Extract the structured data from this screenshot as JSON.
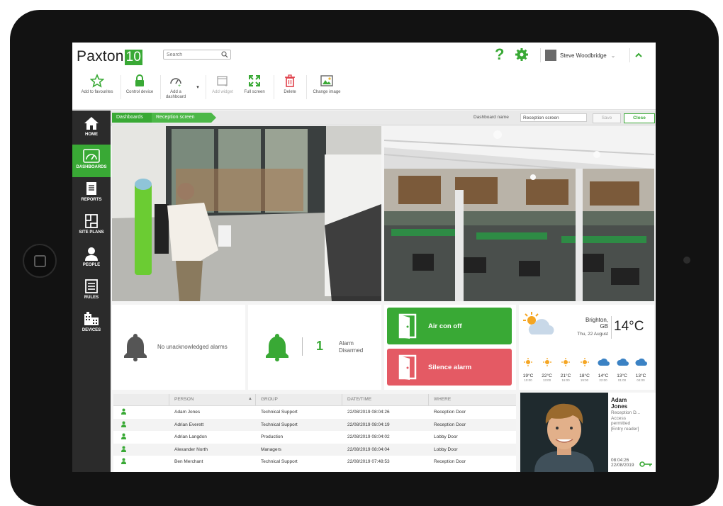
{
  "header": {
    "logo_text": "Paxton",
    "logo_number": "10",
    "search_placeholder": "Search",
    "user_name": "Steve Woodbridge"
  },
  "toolbar": {
    "add_favourites": "Add to favourites",
    "control_device": "Control device",
    "add_dashboard_1": "Add a",
    "add_dashboard_2": "dashboard",
    "add_widget": "Add widget",
    "full_screen": "Full screen",
    "delete": "Delete",
    "change_image": "Change image"
  },
  "sidebar": {
    "items": [
      {
        "label": "HOME"
      },
      {
        "label": "DASHBOARDS"
      },
      {
        "label": "REPORTS"
      },
      {
        "label": "SITE PLANS"
      },
      {
        "label": "PEOPLE"
      },
      {
        "label": "RULES"
      },
      {
        "label": "DEVICES"
      }
    ]
  },
  "breadcrumb": {
    "items": [
      "Dashboards",
      "Reception screen"
    ],
    "dashboard_name_label": "Dashboard name",
    "dashboard_name_value": "Reception screen",
    "save_label": "Save",
    "close_label": "Close"
  },
  "widgets": {
    "no_alarms": "No unacknowledged alarms",
    "alarm_count": "1",
    "alarm_line1": "Alarm",
    "alarm_line2": "Disarmed",
    "aircon_label": "Air con off",
    "silence_label": "Silence alarm"
  },
  "weather": {
    "city": "Brighton,",
    "country": "GB",
    "date": "Thu, 22 August",
    "temperature": "14°C",
    "forecast": [
      {
        "temp": "19°C",
        "time": "10:00"
      },
      {
        "temp": "22°C",
        "time": "13:00"
      },
      {
        "temp": "21°C",
        "time": "16:00"
      },
      {
        "temp": "18°C",
        "time": "19:00"
      },
      {
        "temp": "14°C",
        "time": "22:00"
      },
      {
        "temp": "13°C",
        "time": "01:00"
      },
      {
        "temp": "13°C",
        "time": "04:00"
      }
    ]
  },
  "table": {
    "columns": [
      "PERSON",
      "GROUP",
      "DATE/TIME",
      "WHERE"
    ],
    "rows": [
      {
        "person": "Adam Jones",
        "group": "Technical Support",
        "datetime": "22/08/2019 08:04:26",
        "where": "Reception Door"
      },
      {
        "person": "Adrian Everett",
        "group": "Technical Support",
        "datetime": "22/08/2019 08:04:19",
        "where": "Reception Door"
      },
      {
        "person": "Adrian Langdon",
        "group": "Production",
        "datetime": "22/08/2019 08:04:02",
        "where": "Lobby Door"
      },
      {
        "person": "Alexander North",
        "group": "Managers",
        "datetime": "22/08/2019 08:04:04",
        "where": "Lobby Door"
      },
      {
        "person": "Ben Merchant",
        "group": "Technical Support",
        "datetime": "22/08/2019 07:48:53",
        "where": "Reception Door"
      }
    ]
  },
  "person_panel": {
    "name1": "Adam",
    "name2": "Jones",
    "line1": "Reception D...",
    "line2": "Access",
    "line3": "permitted",
    "line4": "[Entry reader]",
    "time1": "08:04:26",
    "time2": "22/08/2019"
  },
  "colors": {
    "accent": "#39a935",
    "danger": "#e45a64",
    "sidebar": "#2b2b2b"
  }
}
